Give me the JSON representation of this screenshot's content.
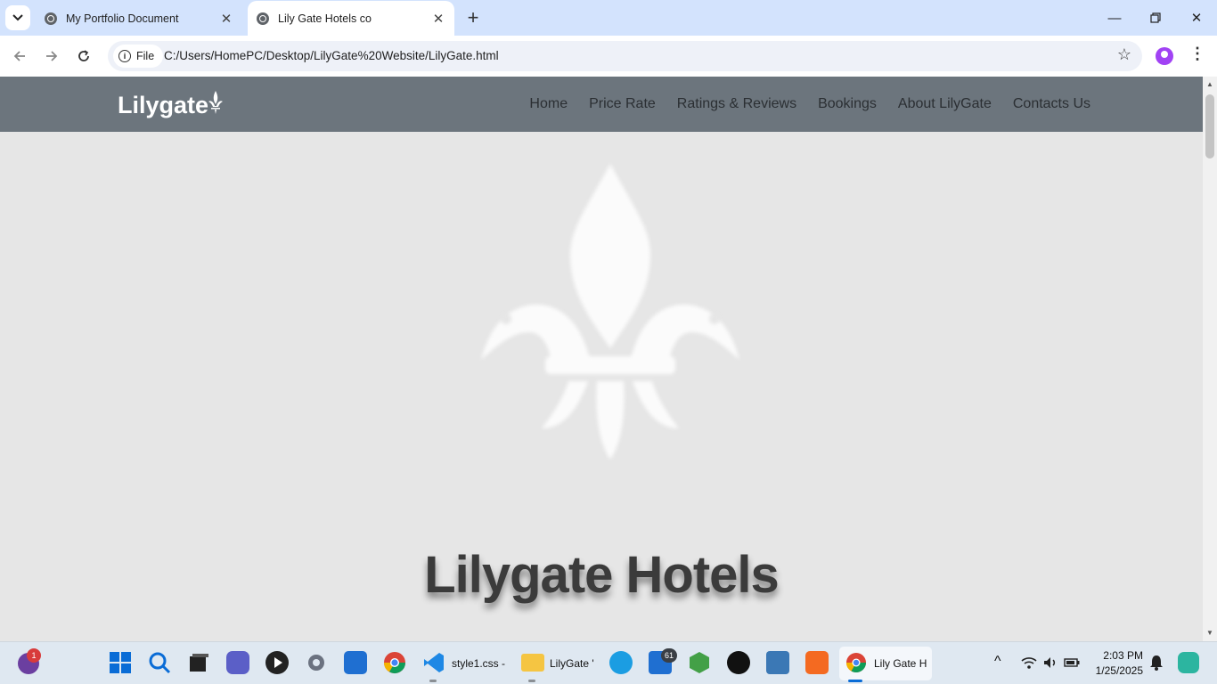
{
  "browser": {
    "tabs": [
      {
        "title": "My Portfolio Document",
        "active": false
      },
      {
        "title": "Lily Gate Hotels co",
        "active": true
      }
    ],
    "address": {
      "chip": "File",
      "url": "C:/Users/HomePC/Desktop/LilyGate%20Website/LilyGate.html"
    }
  },
  "site": {
    "logo_text": "Lilygate",
    "nav": [
      "Home",
      "Price Rate",
      "Ratings & Reviews",
      "Bookings",
      "About LilyGate",
      "Contacts Us"
    ],
    "hero_title": "Lilygate Hotels"
  },
  "taskbar": {
    "notification_badge": "1",
    "mail_badge": "61",
    "apps": [
      {
        "name": "style1.css -"
      },
      {
        "name": "LilyGate '"
      },
      {
        "name": "Lily Gate H"
      }
    ],
    "clock": {
      "time": "2:03 PM",
      "date": "1/25/2025"
    }
  },
  "colors": {
    "site_nav_bg": "#6c757d",
    "page_bg": "#e6e6e6",
    "tab_strip": "#d3e3fd"
  }
}
